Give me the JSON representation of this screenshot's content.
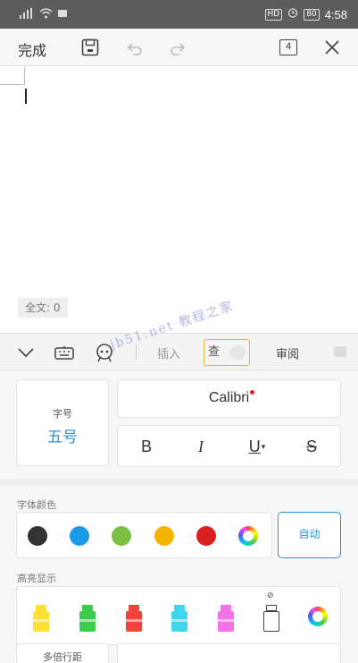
{
  "status_bar": {
    "carrier_signal": "⁴ᴵˡ",
    "hd_label": "HD",
    "battery_label": "80",
    "time": "4:58"
  },
  "toolbar": {
    "done_label": "完成",
    "page_count": "4"
  },
  "document": {
    "word_count": "全文: 0"
  },
  "tabs": {
    "insert": "插入",
    "start": "查",
    "review": "审阅"
  },
  "font_panel": {
    "size_label": "字号",
    "size_value": "五号",
    "font_name": "Calibri",
    "bold": "B",
    "italic": "I",
    "underline": "U",
    "underline_arrow": "▾",
    "strike": "S",
    "font_color_label": "字体颜色",
    "auto_label": "自动",
    "highlight_label": "高亮显示",
    "no_color_symbol": "⊘",
    "spacing_label": "多倍行距"
  },
  "font_colors": [
    "#333333",
    "#1a9be5",
    "#7bc043",
    "#f5b400",
    "#d91f1f"
  ],
  "highlight_colors": [
    "#ffe033",
    "#3ccc4e",
    "#f0443a",
    "#3fd6ee",
    "#f472e8"
  ],
  "watermark": "jb51.net 教程之家"
}
